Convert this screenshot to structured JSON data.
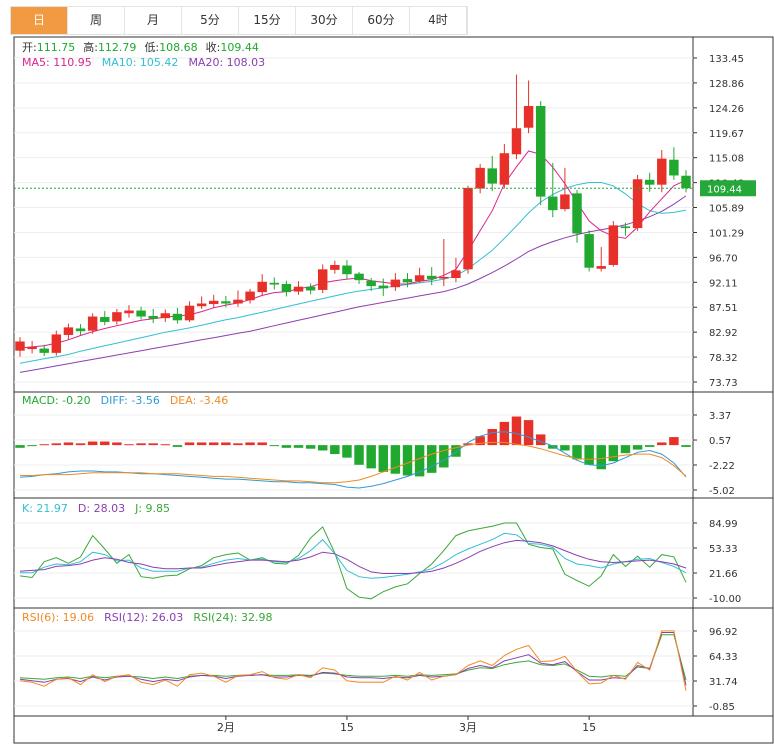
{
  "tabs": [
    "日",
    "周",
    "月",
    "5分",
    "15分",
    "30分",
    "60分",
    "4时"
  ],
  "active_tab": "日",
  "colors": {
    "up": "#e8302a",
    "down": "#20a82f",
    "ma5": "#d9248a",
    "ma10": "#33bfd4",
    "ma20": "#8b3fb0",
    "dif": "#2f9ad6",
    "dea": "#f08a24",
    "k": "#33bfd4",
    "d": "#8b3fb0",
    "j": "#3aa839",
    "rsi6": "#f08a24",
    "rsi12": "#8b3fb0",
    "rsi24": "#3aa839",
    "grid": "#eeeeee",
    "axis": "#333333",
    "last": "#25a83a"
  },
  "header": {
    "ohlc": [
      {
        "label": "开:",
        "value": "111.75"
      },
      {
        "label": "高:",
        "value": "112.79"
      },
      {
        "label": "低:",
        "value": "108.68"
      },
      {
        "label": "收:",
        "value": "109.44"
      }
    ],
    "ma": [
      {
        "label": "MA5: 110.95",
        "key": "ma5"
      },
      {
        "label": "MA10: 105.42",
        "key": "ma10"
      },
      {
        "label": "MA20: 108.03",
        "key": "ma20"
      }
    ]
  },
  "chart_data": [
    {
      "type": "candlestick",
      "y_ticks": [
        "133.45",
        "128.86",
        "124.26",
        "119.67",
        "115.08",
        "110.48",
        "105.89",
        "101.29",
        "96.70",
        "92.11",
        "87.51",
        "82.92",
        "78.32",
        "73.73"
      ],
      "ylim": [
        73.73,
        133.45
      ],
      "last_price": "109.44",
      "x_labels": [
        {
          "label": "2月",
          "index": 17
        },
        {
          "label": "15",
          "index": 27
        },
        {
          "label": "3月",
          "index": 37
        },
        {
          "label": "15",
          "index": 47
        }
      ],
      "candles": [
        [
          79.5,
          81.2,
          78.4,
          82.0
        ],
        [
          79.8,
          80.2,
          79.0,
          81.3
        ],
        [
          79.9,
          79.1,
          78.5,
          80.6
        ],
        [
          79.1,
          82.5,
          78.6,
          83.2
        ],
        [
          82.4,
          83.8,
          81.5,
          84.5
        ],
        [
          83.6,
          83.1,
          82.4,
          84.4
        ],
        [
          83.2,
          85.8,
          82.6,
          86.4
        ],
        [
          85.7,
          84.8,
          84.2,
          86.8
        ],
        [
          84.9,
          86.6,
          84.3,
          87.2
        ],
        [
          86.4,
          86.9,
          85.6,
          87.9
        ],
        [
          86.9,
          85.8,
          85.3,
          87.6
        ],
        [
          85.9,
          85.4,
          84.6,
          87.2
        ],
        [
          85.5,
          86.4,
          84.8,
          87.1
        ],
        [
          86.3,
          85.1,
          84.5,
          87.4
        ],
        [
          85.1,
          87.8,
          84.8,
          88.6
        ],
        [
          87.7,
          88.2,
          87.2,
          89.5
        ],
        [
          88.1,
          88.7,
          87.4,
          89.8
        ],
        [
          88.6,
          88.2,
          87.5,
          89.6
        ],
        [
          88.2,
          88.9,
          87.6,
          90.6
        ],
        [
          88.8,
          90.4,
          88.2,
          90.9
        ],
        [
          90.3,
          92.2,
          89.6,
          93.6
        ],
        [
          92.0,
          91.7,
          90.8,
          93.0
        ],
        [
          91.8,
          90.3,
          89.5,
          92.4
        ],
        [
          90.4,
          91.3,
          89.8,
          92.3
        ],
        [
          91.3,
          90.6,
          89.9,
          91.9
        ],
        [
          90.7,
          94.5,
          90.1,
          95.4
        ],
        [
          94.4,
          95.3,
          93.7,
          96.1
        ],
        [
          95.2,
          93.6,
          92.6,
          96.2
        ],
        [
          93.7,
          92.5,
          91.8,
          94.0
        ],
        [
          92.4,
          91.4,
          90.5,
          92.9
        ],
        [
          91.5,
          91.0,
          89.6,
          92.8
        ],
        [
          91.2,
          92.6,
          90.5,
          93.8
        ],
        [
          92.7,
          92.1,
          91.2,
          93.8
        ],
        [
          92.3,
          93.4,
          92.0,
          94.8
        ],
        [
          93.3,
          92.7,
          91.6,
          94.9
        ],
        [
          92.8,
          93.1,
          91.4,
          100.1
        ],
        [
          92.9,
          94.3,
          92.1,
          96.6
        ],
        [
          94.5,
          109.5,
          93.7,
          109.9
        ],
        [
          109.4,
          113.2,
          108.5,
          113.9
        ],
        [
          113.1,
          110.3,
          108.9,
          115.4
        ],
        [
          110.1,
          115.9,
          109.4,
          117.6
        ],
        [
          115.7,
          120.5,
          114.8,
          130.4
        ],
        [
          120.6,
          124.6,
          119.6,
          129.3
        ],
        [
          124.6,
          107.9,
          106.3,
          125.5
        ],
        [
          107.9,
          105.4,
          104.1,
          114.1
        ],
        [
          105.6,
          108.3,
          105.2,
          113.2
        ],
        [
          108.5,
          101.1,
          99.4,
          109.1
        ],
        [
          101.0,
          94.8,
          94.1,
          101.7
        ],
        [
          94.6,
          95.1,
          94.1,
          98.6
        ],
        [
          95.3,
          102.6,
          95.0,
          103.4
        ],
        [
          102.4,
          102.1,
          100.7,
          103.1
        ],
        [
          102.1,
          111.1,
          101.6,
          111.9
        ],
        [
          111.0,
          110.1,
          108.8,
          112.3
        ],
        [
          110.1,
          114.9,
          108.7,
          116.5
        ],
        [
          114.7,
          111.8,
          111.0,
          117.0
        ],
        [
          111.75,
          109.44,
          108.68,
          112.79
        ]
      ],
      "ma5": [
        80.0,
        80.2,
        80.4,
        80.9,
        81.5,
        82.3,
        83.0,
        83.6,
        84.1,
        84.6,
        85.1,
        85.4,
        85.7,
        85.9,
        86.1,
        86.7,
        87.4,
        87.9,
        88.3,
        88.9,
        89.7,
        90.2,
        90.4,
        90.9,
        91.3,
        92.0,
        92.4,
        92.7,
        92.9,
        92.4,
        92.1,
        91.8,
        91.8,
        92.3,
        92.6,
        93.4,
        94.5,
        97.9,
        101.6,
        105.3,
        110.3,
        113.4,
        116.3,
        115.7,
        113.3,
        110.3,
        106.8,
        103.4,
        101.6,
        100.6,
        100.2,
        102.3,
        105.1,
        107.5,
        109.9,
        110.95
      ],
      "ma10": [
        77.2,
        77.6,
        78.0,
        78.4,
        78.8,
        79.4,
        79.9,
        80.4,
        80.9,
        81.4,
        81.9,
        82.4,
        82.9,
        83.3,
        83.7,
        84.2,
        84.7,
        85.2,
        85.6,
        86.1,
        86.6,
        87.1,
        87.6,
        88.1,
        88.6,
        89.1,
        89.6,
        90.1,
        90.5,
        90.8,
        91.1,
        91.4,
        91.7,
        92.0,
        92.3,
        92.7,
        93.3,
        94.6,
        96.3,
        98.0,
        100.2,
        102.5,
        104.9,
        106.9,
        108.3,
        109.4,
        110.1,
        110.5,
        110.5,
        109.9,
        108.4,
        106.6,
        105.3,
        104.8,
        105.0,
        105.42
      ],
      "ma20": [
        75.5,
        75.9,
        76.3,
        76.7,
        77.1,
        77.5,
        77.9,
        78.3,
        78.7,
        79.1,
        79.5,
        79.9,
        80.3,
        80.7,
        81.1,
        81.5,
        81.9,
        82.3,
        82.7,
        83.1,
        83.6,
        84.1,
        84.6,
        85.1,
        85.6,
        86.1,
        86.6,
        87.1,
        87.6,
        88.0,
        88.4,
        88.8,
        89.2,
        89.6,
        90.0,
        90.4,
        91.0,
        91.8,
        92.8,
        93.9,
        95.1,
        96.4,
        97.8,
        98.8,
        99.6,
        100.3,
        100.9,
        101.4,
        101.8,
        102.2,
        102.7,
        103.4,
        104.2,
        105.2,
        106.5,
        108.03
      ]
    },
    {
      "type": "histogram",
      "name": "MACD",
      "legend": [
        {
          "label": "MACD: -0.20",
          "key": "down"
        },
        {
          "label": "DIFF: -3.56",
          "key": "dif"
        },
        {
          "label": "DEA: -3.46",
          "key": "dea"
        }
      ],
      "y_ticks": [
        "3.37",
        "0.57",
        "-2.22",
        "-5.02"
      ],
      "ylim": [
        -5.02,
        3.37
      ],
      "macd": [
        -0.3,
        -0.1,
        0.1,
        0.2,
        0.3,
        0.2,
        0.4,
        0.4,
        0.3,
        0.1,
        0.2,
        0.2,
        0.1,
        -0.2,
        0.3,
        0.3,
        0.3,
        0.3,
        0.2,
        0.3,
        0.3,
        -0.1,
        -0.3,
        -0.3,
        -0.4,
        -0.6,
        -1.0,
        -1.4,
        -2.2,
        -2.6,
        -3.0,
        -3.2,
        -3.4,
        -3.5,
        -3.1,
        -2.5,
        -1.3,
        0.2,
        1.0,
        1.8,
        2.6,
        3.2,
        2.8,
        1.2,
        -0.4,
        -0.6,
        -1.6,
        -2.2,
        -2.7,
        -1.8,
        -0.9,
        -0.5,
        -0.2,
        0.3,
        0.9,
        -0.2
      ],
      "dif": [
        -3.6,
        -3.5,
        -3.3,
        -3.2,
        -3.0,
        -2.9,
        -2.9,
        -3.0,
        -3.0,
        -3.1,
        -3.2,
        -3.2,
        -3.3,
        -3.4,
        -3.5,
        -3.6,
        -3.7,
        -3.8,
        -3.8,
        -3.9,
        -4.0,
        -4.1,
        -4.1,
        -4.2,
        -4.2,
        -4.3,
        -4.4,
        -4.7,
        -4.8,
        -4.6,
        -4.3,
        -3.9,
        -3.5,
        -3.0,
        -2.4,
        -1.7,
        -0.8,
        0.3,
        1.0,
        1.4,
        1.5,
        1.3,
        0.9,
        0.4,
        -0.1,
        -0.9,
        -1.7,
        -2.2,
        -2.3,
        -2.0,
        -1.4,
        -0.8,
        -0.6,
        -1.0,
        -2.0,
        -3.56
      ],
      "dea": [
        -3.4,
        -3.4,
        -3.3,
        -3.3,
        -3.3,
        -3.2,
        -3.1,
        -3.1,
        -3.1,
        -3.1,
        -3.1,
        -3.2,
        -3.2,
        -3.2,
        -3.3,
        -3.4,
        -3.5,
        -3.5,
        -3.6,
        -3.7,
        -3.8,
        -3.9,
        -4.0,
        -4.0,
        -4.1,
        -4.2,
        -4.2,
        -4.1,
        -3.9,
        -3.5,
        -3.0,
        -2.5,
        -2.0,
        -1.5,
        -1.0,
        -0.6,
        -0.3,
        0.0,
        0.2,
        0.3,
        0.3,
        0.1,
        -0.1,
        -0.4,
        -0.8,
        -1.2,
        -1.5,
        -1.6,
        -1.5,
        -1.3,
        -1.1,
        -1.0,
        -1.0,
        -1.4,
        -2.3,
        -3.46
      ]
    },
    {
      "type": "line",
      "name": "KDJ",
      "legend": [
        {
          "label": "K: 21.97",
          "key": "k"
        },
        {
          "label": "D: 28.03",
          "key": "d"
        },
        {
          "label": "J: 9.85",
          "key": "j"
        }
      ],
      "y_ticks": [
        "84.99",
        "53.33",
        "21.66",
        "-10.00"
      ],
      "ylim": [
        -10.0,
        84.99
      ],
      "k": [
        22,
        22,
        29,
        33,
        32,
        36,
        48,
        45,
        37,
        38,
        28,
        24,
        24,
        24,
        28,
        29,
        34,
        38,
        40,
        38,
        39,
        36,
        35,
        40,
        50,
        64,
        46,
        25,
        17,
        15,
        16,
        18,
        20,
        23,
        27,
        35,
        45,
        52,
        58,
        64,
        72,
        70,
        59,
        58,
        54,
        40,
        33,
        31,
        28,
        33,
        36,
        39,
        40,
        35,
        30,
        21.97
      ],
      "d": [
        24,
        25,
        26,
        30,
        31,
        33,
        38,
        41,
        39,
        35,
        33,
        29,
        27,
        27,
        28,
        28,
        31,
        34,
        36,
        38,
        38,
        37,
        36,
        38,
        42,
        48,
        46,
        39,
        30,
        23,
        21,
        21,
        21,
        22,
        24,
        28,
        34,
        41,
        49,
        55,
        60,
        63,
        62,
        60,
        56,
        50,
        44,
        39,
        36,
        35,
        36,
        37,
        38,
        36,
        33,
        28.03
      ],
      "j": [
        18,
        16,
        36,
        41,
        34,
        42,
        69,
        52,
        34,
        45,
        17,
        15,
        18,
        19,
        27,
        31,
        41,
        45,
        47,
        38,
        41,
        34,
        33,
        44,
        66,
        80,
        47,
        2,
        -9,
        -11,
        -2,
        4,
        8,
        21,
        33,
        50,
        69,
        75,
        78,
        81,
        85,
        85,
        58,
        54,
        52,
        20,
        12,
        5,
        18,
        45,
        30,
        43,
        29,
        45,
        42,
        9.85
      ]
    },
    {
      "type": "line",
      "name": "RSI",
      "legend": [
        {
          "label": "RSI(6): 19.06",
          "key": "rsi6"
        },
        {
          "label": "RSI(12): 26.03",
          "key": "rsi12"
        },
        {
          "label": "RSI(24): 32.98",
          "key": "rsi24"
        }
      ],
      "y_ticks": [
        "96.92",
        "64.33",
        "31.74",
        "-0.85"
      ],
      "ylim": [
        -0.85,
        96.92
      ],
      "rsi6": [
        32,
        30,
        25,
        34,
        36,
        27,
        40,
        31,
        38,
        40,
        30,
        27,
        33,
        25,
        40,
        42,
        38,
        30,
        39,
        40,
        44,
        36,
        34,
        40,
        36,
        49,
        46,
        32,
        30,
        30,
        30,
        38,
        33,
        43,
        33,
        38,
        40,
        52,
        58,
        52,
        65,
        73,
        78,
        57,
        58,
        64,
        44,
        28,
        29,
        39,
        34,
        56,
        46,
        97,
        97,
        19.06
      ],
      "rsi12": [
        34,
        32,
        30,
        34,
        35,
        31,
        37,
        33,
        37,
        38,
        34,
        31,
        34,
        32,
        37,
        39,
        38,
        35,
        38,
        39,
        40,
        37,
        37,
        39,
        38,
        43,
        42,
        37,
        36,
        36,
        35,
        37,
        36,
        39,
        37,
        38,
        40,
        48,
        52,
        49,
        58,
        62,
        66,
        55,
        53,
        57,
        44,
        33,
        33,
        36,
        35,
        52,
        48,
        95,
        95,
        26.03
      ],
      "rsi24": [
        36,
        35,
        34,
        36,
        37,
        35,
        38,
        36,
        38,
        38,
        37,
        35,
        37,
        35,
        38,
        39,
        39,
        38,
        39,
        39,
        40,
        39,
        39,
        40,
        39,
        42,
        41,
        39,
        38,
        38,
        38,
        39,
        38,
        40,
        39,
        40,
        41,
        46,
        49,
        48,
        53,
        56,
        58,
        53,
        52,
        54,
        46,
        38,
        37,
        39,
        38,
        50,
        48,
        92,
        92,
        32.98
      ]
    }
  ]
}
